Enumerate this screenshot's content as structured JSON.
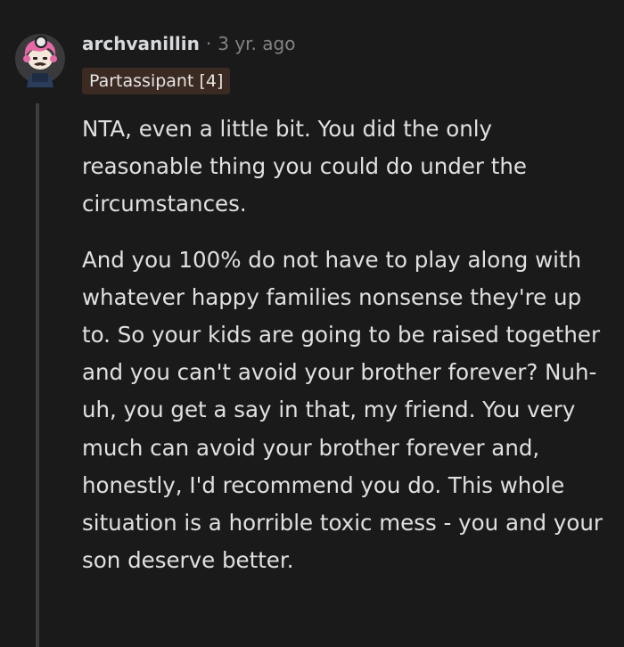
{
  "comment": {
    "author": "archvanillin",
    "separator": "·",
    "age": "3 yr. ago",
    "flair": "Partassipant [4]",
    "avatar_icon": "snoo-avatar-pink-hair-icon",
    "paragraphs": [
      "NTA, even a little bit. You did the only reasonable thing you could do under the circumstances.",
      "And you 100% do not have to play along with whatever happy families nonsense they're up to. So your kids are going to be raised together and you can't avoid your brother forever? Nuh-uh, you get a say in that, my friend. You very much can avoid your brother forever and, honestly, I'd recommend you do. This whole situation is a horrible toxic mess - you and your son deserve better."
    ]
  },
  "colors": {
    "background": "#1a1a1b",
    "text": "#e0e0e0",
    "muted": "#818384",
    "flair_bg": "#3b2a22",
    "thread_line": "#3d3d3f",
    "avatar_hair": "#e46aa6"
  }
}
